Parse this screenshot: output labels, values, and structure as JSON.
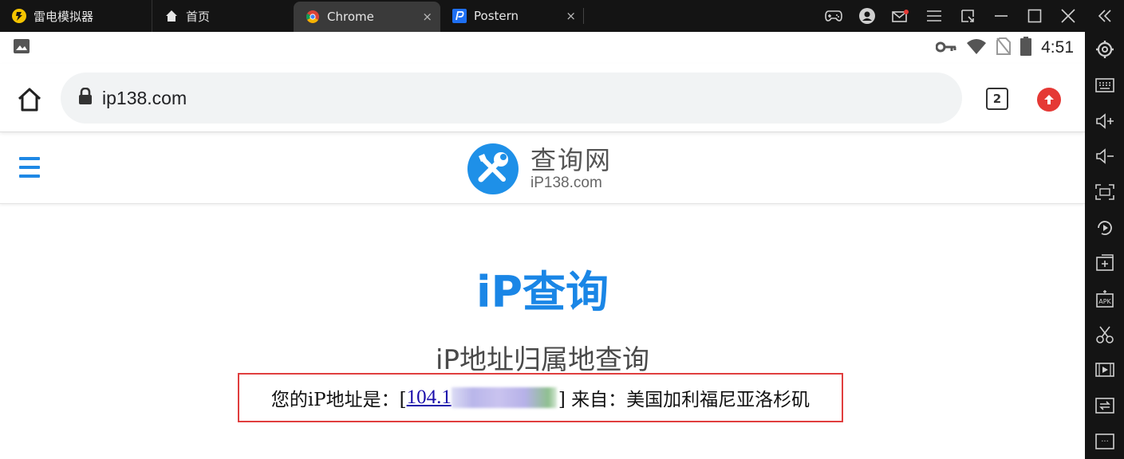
{
  "emulator": {
    "app_name": "雷电模拟器",
    "tabs": [
      {
        "label": "首页"
      },
      {
        "label": "Chrome",
        "close": "×"
      },
      {
        "label": "Postern",
        "close": "×"
      }
    ],
    "controls": [
      "gamepad-icon",
      "account-icon",
      "mail-icon",
      "menu-icon",
      "restore-icon",
      "minimize-icon",
      "maximize-icon",
      "close-icon",
      "collapse-icon"
    ],
    "sidebar": [
      "settings-icon",
      "keyboard-icon",
      "volume-up-icon",
      "volume-down-icon",
      "fullscreen-icon",
      "rotate-icon",
      "add-window-icon",
      "apk-icon",
      "scissors-icon",
      "video-icon",
      "sync-icon",
      "more-icon"
    ],
    "apk_label": "APK",
    "more_label": "···"
  },
  "statusbar": {
    "time": "4:51"
  },
  "browser": {
    "url": "ip138.com",
    "tab_count": "2"
  },
  "site": {
    "logo_cn": "查询网",
    "logo_en": "iP138.com",
    "title": "iP查询",
    "subtitle": "iP地址归属地查询",
    "ip_prefix": "您的iP地址是：[",
    "ip_visible": "104.1",
    "ip_suffix": "] 来自：美国加利福尼亚洛杉矶"
  },
  "colors": {
    "accent_blue": "#1a86e6",
    "highlight_red": "#e03e3e",
    "update_red": "#e53935"
  }
}
